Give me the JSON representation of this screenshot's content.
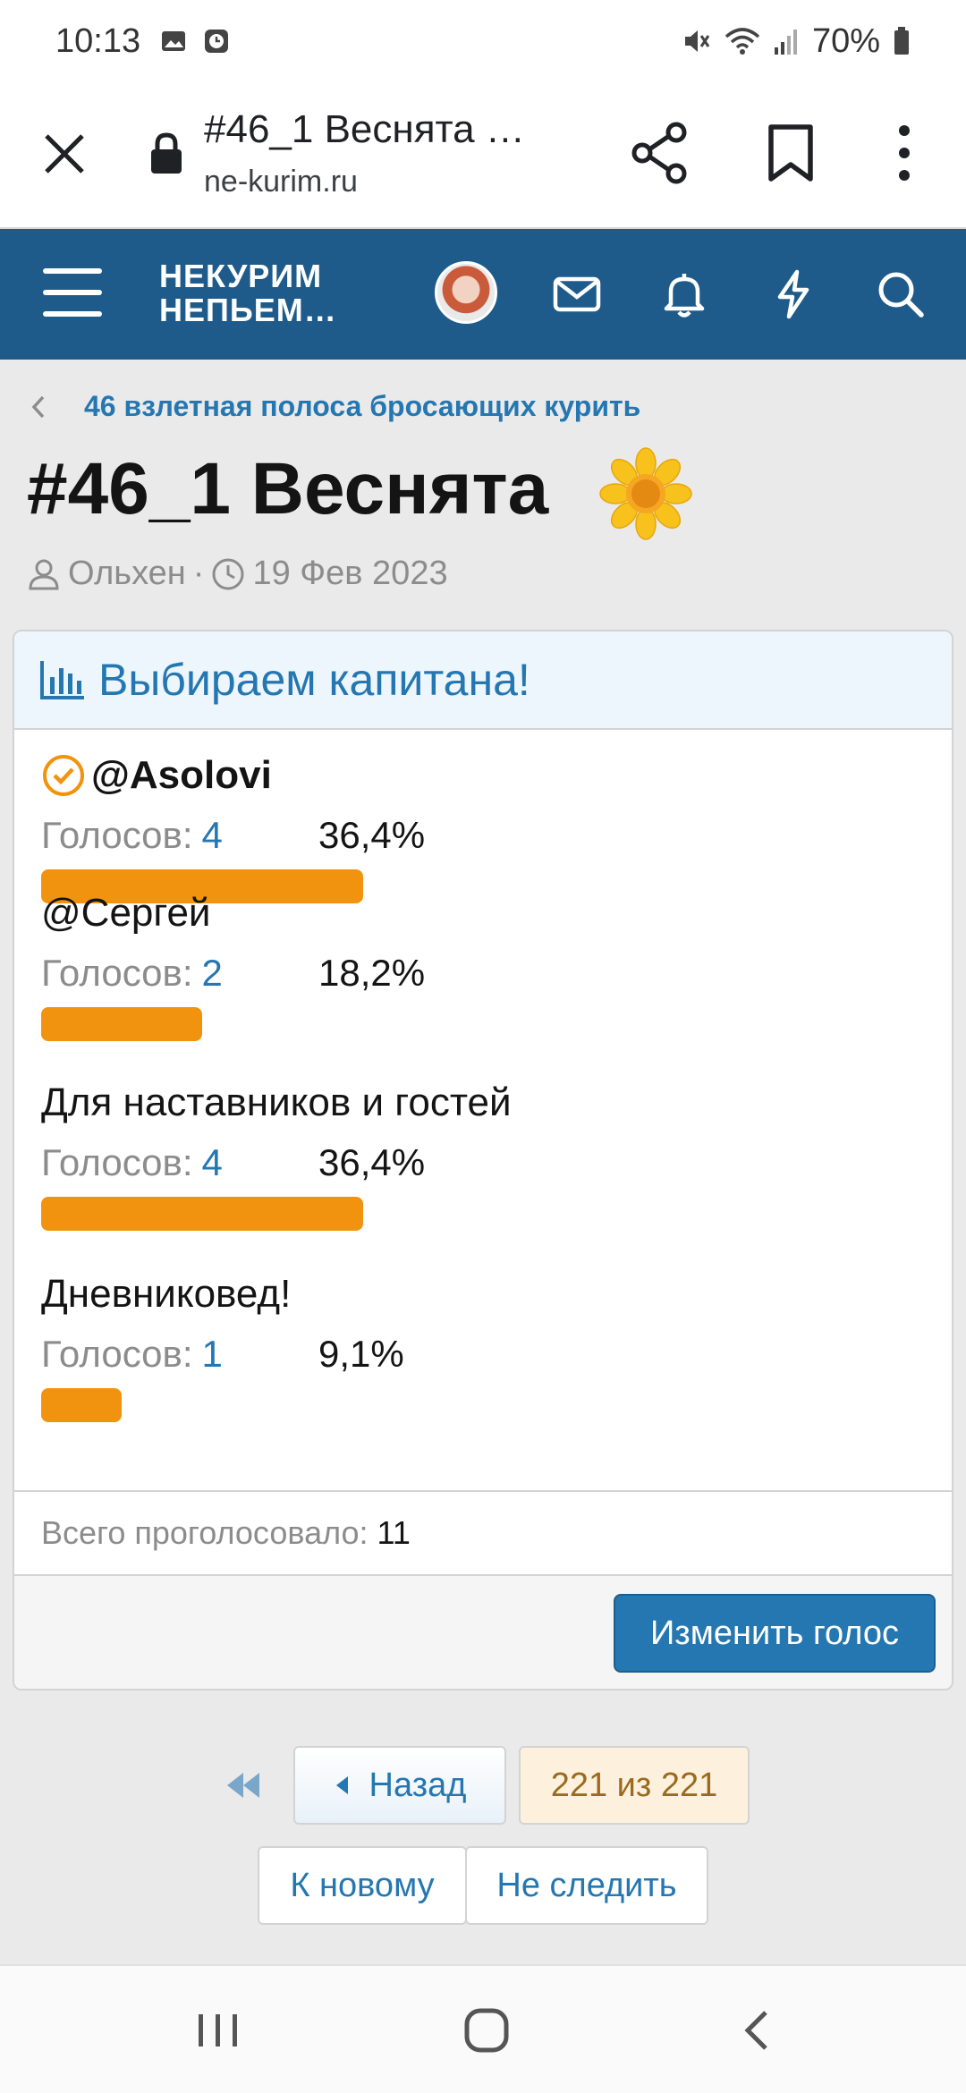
{
  "status_bar": {
    "time": "10:13",
    "battery": "70%",
    "icons": [
      "gallery-icon",
      "clock-icon",
      "mute-icon",
      "wifi-icon",
      "signal-icon",
      "battery-icon"
    ]
  },
  "browser": {
    "tab_title": "#46_1 Веснята …",
    "url": "ne-kurim.ru"
  },
  "site_header": {
    "logo_line1": "НЕКУРИМ",
    "logo_line2": "НЕПЬЕМ…",
    "brand_color": "#1e5b8a"
  },
  "breadcrumb": {
    "label": "46 взлетная полоса бросающих курить"
  },
  "thread": {
    "title": "#46_1 Веснята",
    "author": "Ольхен",
    "separator": "·",
    "date": "19 Фев 2023"
  },
  "poll": {
    "title": "Выбираем капитана!",
    "votes_caption": "Голосов:",
    "options": [
      {
        "label": "@Asolovi",
        "votes": "4",
        "percent": "36,4%",
        "fraction": 0.364,
        "selected": true
      },
      {
        "label": "@Сергей",
        "votes": "2",
        "percent": "18,2%",
        "fraction": 0.182,
        "selected": false
      },
      {
        "label": "Для наставников и гостей",
        "votes": "4",
        "percent": "36,4%",
        "fraction": 0.364,
        "selected": false
      },
      {
        "label": "Дневниковед!",
        "votes": "1",
        "percent": "9,1%",
        "fraction": 0.091,
        "selected": false
      }
    ],
    "total_caption": "Всего проголосовало:",
    "total_value": "11",
    "change_vote_label": "Изменить голос",
    "bar_color": "#f2930f"
  },
  "pagination": {
    "prev_label": "Назад",
    "current": "221 из 221",
    "new_label": "К новому",
    "unwatch_label": "Не следить"
  }
}
